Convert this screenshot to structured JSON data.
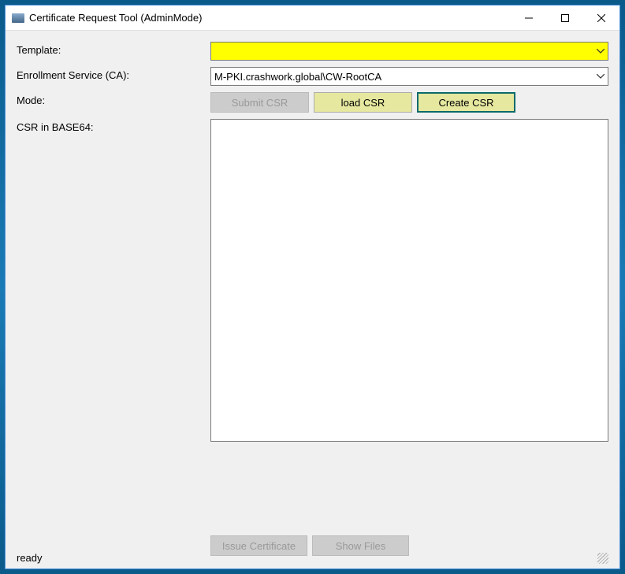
{
  "window": {
    "title": "Certificate Request Tool (AdminMode)"
  },
  "labels": {
    "template": "Template:",
    "enrollment": "Enrollment Service (CA):",
    "mode": "Mode:",
    "csr": "CSR in BASE64:"
  },
  "fields": {
    "template_value": "",
    "enrollment_value": "M-PKI.crashwork.global\\CW-RootCA",
    "csr_value": ""
  },
  "buttons": {
    "submit_csr": "Submit CSR",
    "load_csr": "load CSR",
    "create_csr": "Create CSR",
    "issue_cert": "Issue Certificate",
    "show_files": "Show Files"
  },
  "status": "ready"
}
